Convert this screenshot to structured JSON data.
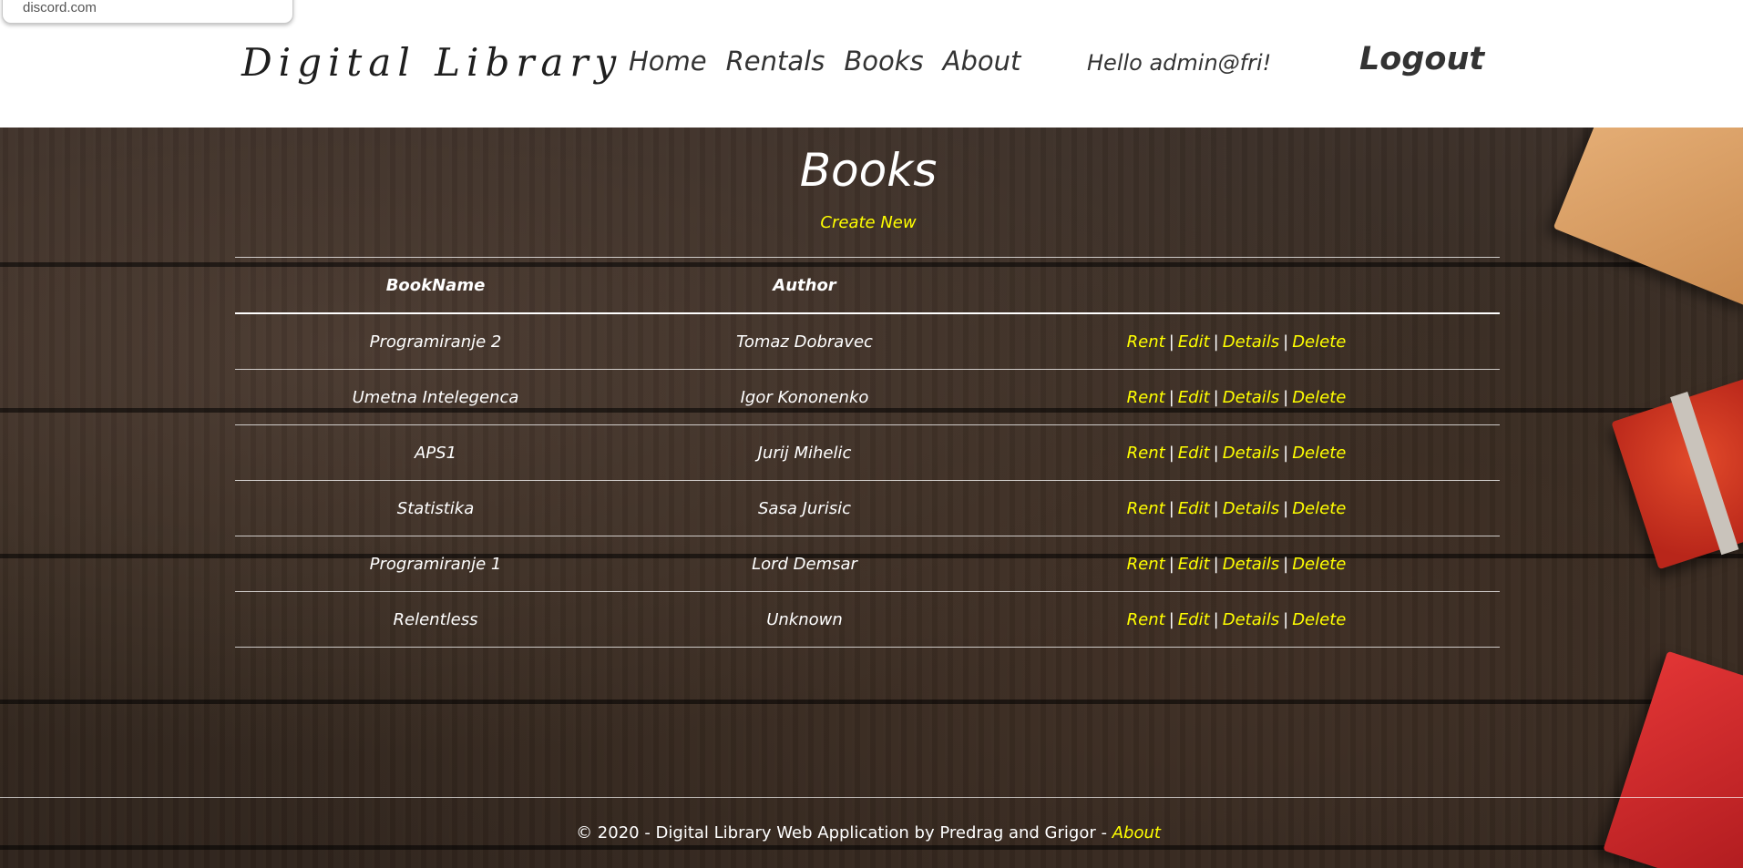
{
  "browser": {
    "url_fragment": "discord.com"
  },
  "header": {
    "brand": "Digital Library",
    "nav": [
      "Home",
      "Rentals",
      "Books",
      "About"
    ],
    "greeting": "Hello admin@fri!",
    "logout_label": "Logout"
  },
  "main": {
    "title": "Books",
    "create_new_label": "Create New",
    "table": {
      "headers": [
        "BookName",
        "Author"
      ],
      "rows": [
        {
          "book": "Programiranje 2",
          "author": "Tomaz Dobravec"
        },
        {
          "book": "Umetna Intelegenca",
          "author": "Igor Kononenko"
        },
        {
          "book": "APS1",
          "author": "Jurij Mihelic"
        },
        {
          "book": "Statistika",
          "author": "Sasa Jurisic"
        },
        {
          "book": "Programiranje 1",
          "author": "Lord Demsar"
        },
        {
          "book": "Relentless",
          "author": "Unknown"
        }
      ],
      "actions": [
        "Rent",
        "Edit",
        "Details",
        "Delete"
      ],
      "separator": "|"
    }
  },
  "footer": {
    "text": "© 2020 - Digital Library Web Application by Predrag and Grigor -",
    "link_label": "About"
  },
  "colors": {
    "link": "#ffff00",
    "text_light": "#ffffff",
    "header_text": "#333333",
    "wood": "#35291f"
  }
}
